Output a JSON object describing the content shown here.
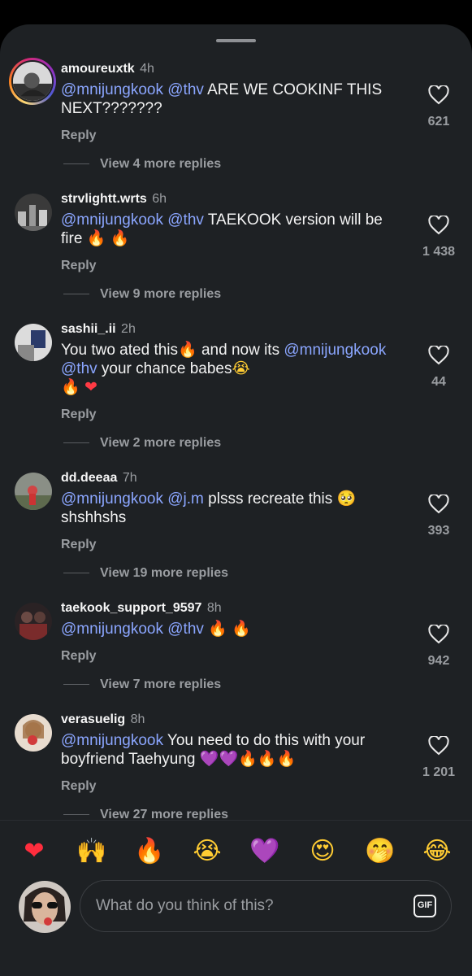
{
  "input": {
    "placeholder": "What do you think of this?",
    "gif_label": "GIF"
  },
  "reactions": [
    "❤",
    "🙌",
    "🔥",
    "😭",
    "💜",
    "😍",
    "🤭",
    "😂"
  ],
  "comments": [
    {
      "username": "amoureuxtk",
      "time": "4h",
      "segments": [
        [
          "m",
          "@mnijungkook"
        ],
        [
          "t",
          " "
        ],
        [
          "m",
          "@thv"
        ],
        [
          "t",
          " ARE WE COOKINF THIS NEXT???????"
        ]
      ],
      "reply": "Reply",
      "likes": "621",
      "more_replies": "View 4 more replies"
    },
    {
      "username": "strvlightt.wrts",
      "time": "6h",
      "segments": [
        [
          "m",
          "@mnijungkook"
        ],
        [
          "t",
          " "
        ],
        [
          "m",
          "@thv"
        ],
        [
          "t",
          " TAEKOOK version will be fire "
        ],
        [
          "e",
          "🔥"
        ],
        [
          "t",
          " "
        ],
        [
          "e",
          "🔥"
        ]
      ],
      "reply": "Reply",
      "likes": "1 438",
      "more_replies": "View 9 more replies"
    },
    {
      "username": "sashii_.ii",
      "time": "2h",
      "segments": [
        [
          "t",
          "You two ated this"
        ],
        [
          "e",
          "🔥"
        ],
        [
          "t",
          " and now its "
        ],
        [
          "m",
          "@mnijungkook"
        ],
        [
          "t",
          " "
        ],
        [
          "m",
          "@thv"
        ],
        [
          "t",
          "  your chance babes"
        ],
        [
          "e",
          "😭"
        ],
        [
          "br",
          ""
        ],
        [
          "e",
          "🔥"
        ],
        [
          "t",
          " "
        ],
        [
          "e",
          "❤"
        ]
      ],
      "reply": "Reply",
      "likes": "44",
      "more_replies": "View 2 more replies"
    },
    {
      "username": "dd.deeaa",
      "time": "7h",
      "segments": [
        [
          "m",
          "@mnijungkook"
        ],
        [
          "t",
          " "
        ],
        [
          "m",
          "@j.m"
        ],
        [
          "t",
          " plsss recreate this "
        ],
        [
          "e",
          "🥺"
        ],
        [
          "t",
          " shshhshs"
        ]
      ],
      "reply": "Reply",
      "likes": "393",
      "more_replies": "View 19 more replies"
    },
    {
      "username": "taekook_support_9597",
      "time": "8h",
      "segments": [
        [
          "m",
          "@mnijungkook"
        ],
        [
          "t",
          " "
        ],
        [
          "m",
          "@thv"
        ],
        [
          "t",
          " "
        ],
        [
          "e",
          "🔥"
        ],
        [
          "t",
          " "
        ],
        [
          "e",
          "🔥"
        ]
      ],
      "reply": "Reply",
      "likes": "942",
      "more_replies": "View 7 more replies"
    },
    {
      "username": "verasuelig",
      "time": "8h",
      "segments": [
        [
          "m",
          "@mnijungkook"
        ],
        [
          "t",
          " You need to do this with your boyfriend Taehyung "
        ],
        [
          "e",
          "💜"
        ],
        [
          "e",
          "💜"
        ],
        [
          "e",
          "🔥"
        ],
        [
          "e",
          "🔥"
        ],
        [
          "e",
          "🔥"
        ]
      ],
      "reply": "Reply",
      "likes": "1 201",
      "more_replies": "View 27 more replies"
    }
  ]
}
